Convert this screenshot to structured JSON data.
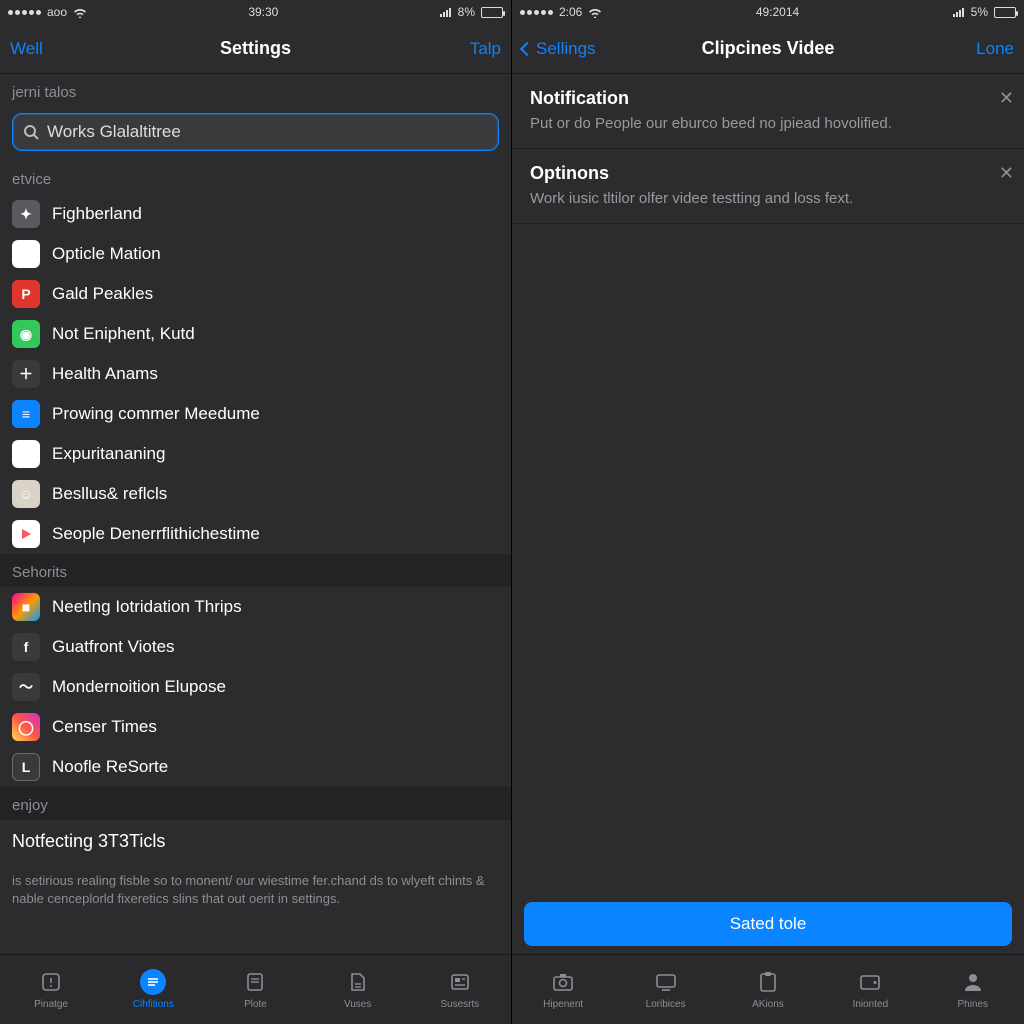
{
  "left": {
    "statusbar": {
      "carrier": "aoo",
      "time": "39:30",
      "battery_pct": "8%"
    },
    "navbar": {
      "left": "Well",
      "title": "Settings",
      "right": "Talp"
    },
    "section1_header": "jerni talos",
    "search_placeholder": "Works Glalaltitree",
    "section2_header": "etvice",
    "items1": [
      {
        "label": "Fighberland"
      },
      {
        "label": "Opticle Mation"
      },
      {
        "label": "Gald Peakles"
      },
      {
        "label": "Not Eniphent, Kutd"
      },
      {
        "label": "Health Anams"
      },
      {
        "label": "Prowing commer Meedume"
      },
      {
        "label": "Expuritananing"
      },
      {
        "label": "Besllus& reflcls"
      },
      {
        "label": "Seople Denerrflithichestime"
      }
    ],
    "section3_header": "Sehorits",
    "items2": [
      {
        "label": "Neetlng Iotridation Thrips"
      },
      {
        "label": "Guatfront Viotes"
      },
      {
        "label": "Mondernoition Elupose"
      },
      {
        "label": "Censer Times"
      },
      {
        "label": "Noofle ReSorte"
      }
    ],
    "section4_header": "enjoy",
    "notfecting_label": "Notfecting 3T3Ticls",
    "footnote": "is setirious realing fisble so to monent/ our wiestime fer.chand ds to wlyeft chints & nable cenceplorld fixeretics slins that out oerit in settings.",
    "tabs": [
      {
        "label": "Pinatge"
      },
      {
        "label": "Cihfitions"
      },
      {
        "label": "Plote"
      },
      {
        "label": "Vuses"
      },
      {
        "label": "Susesrts"
      }
    ]
  },
  "right": {
    "statusbar": {
      "time_left": "2:06",
      "time_center": "49:2014",
      "battery_pct": "5%"
    },
    "navbar": {
      "back": "Sellings",
      "title": "Clipcines Videe",
      "right": "Lone"
    },
    "cards": [
      {
        "title": "Notification",
        "sub": "Put or do People our eburco beed no jpiead hovolified."
      },
      {
        "title": "Optinons",
        "sub": "Work iusic tltilor olfer videe testting and loss fext."
      }
    ],
    "primary_button": "Sated tole",
    "tabs": [
      {
        "label": "Hipenent"
      },
      {
        "label": "Loribices"
      },
      {
        "label": "AKions"
      },
      {
        "label": "Inionted"
      },
      {
        "label": "Phines"
      }
    ]
  },
  "colors": {
    "accent": "#0a84ff"
  }
}
